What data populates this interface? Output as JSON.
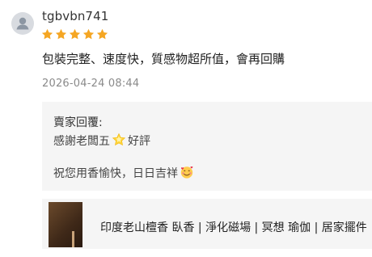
{
  "review": {
    "username": "tgbvbn741",
    "rating": 5,
    "rating_max": 5,
    "star_color": "#f5a623",
    "text": "包裝完整、速度快，質感物超所值，會再回購",
    "timestamp": "2026-04-24 08:44"
  },
  "seller_reply": {
    "title": "賣家回覆:",
    "line1_before": "感謝老闆五",
    "line1_emoji": "glowing-star-emoji",
    "line1_after": "好評",
    "line2_text": "祝您用香愉快，日日吉祥",
    "line2_emoji": "smiling-face-with-hearts-emoji"
  },
  "product": {
    "title": "印度老山檀香 臥香 | 淨化磁場 | 冥想 瑜伽 | 居家擺件"
  }
}
